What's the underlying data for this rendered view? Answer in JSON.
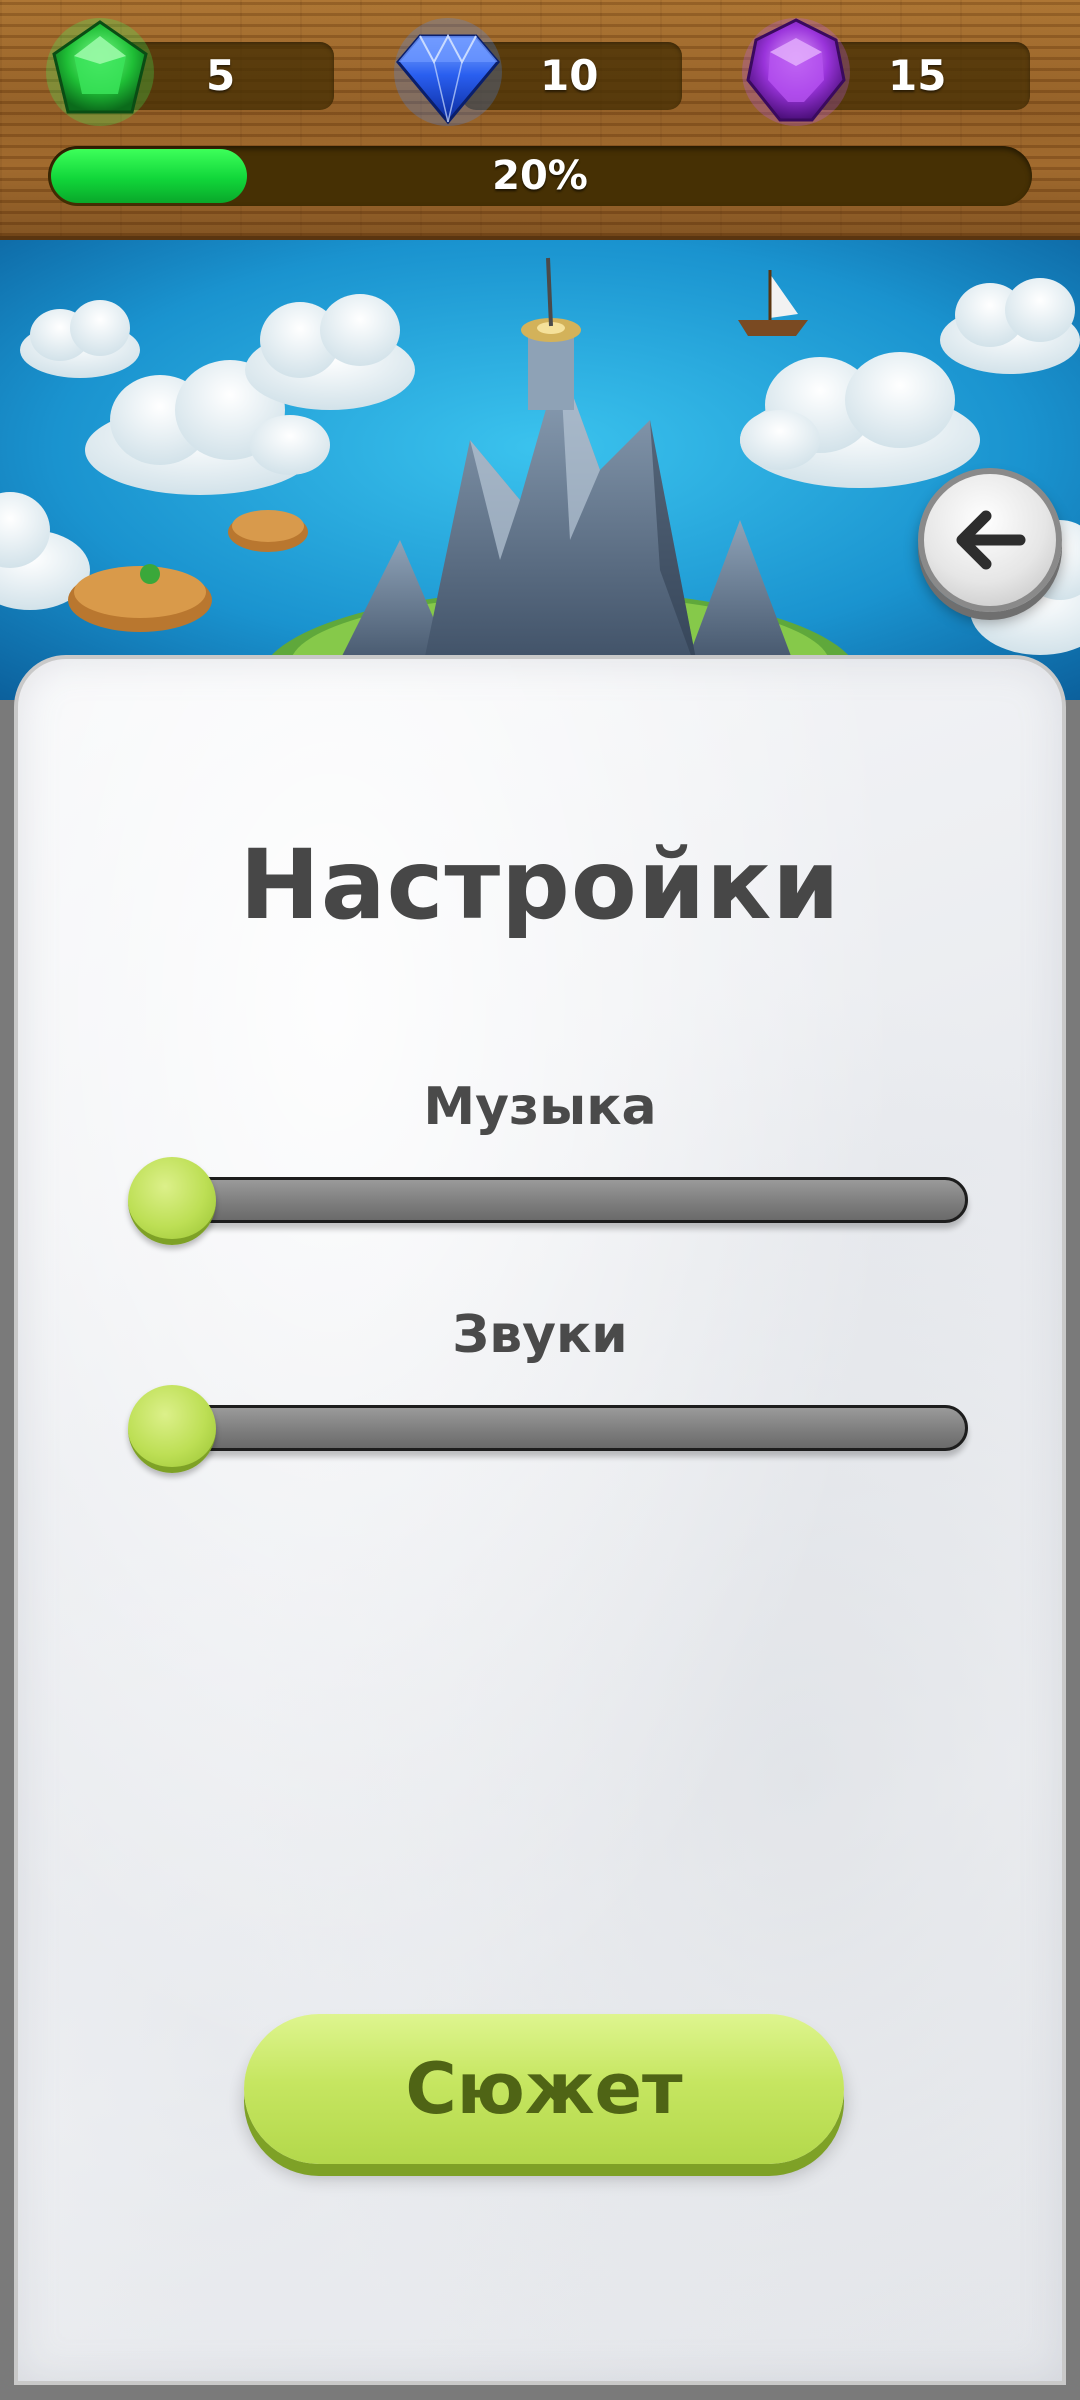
{
  "hud": {
    "gems": [
      {
        "name": "green-gem-icon",
        "count": "5",
        "color": "#22c23a"
      },
      {
        "name": "blue-gem-icon",
        "count": "10",
        "color": "#1f4fe0"
      },
      {
        "name": "purple-gem-icon",
        "count": "15",
        "color": "#8a2bd1"
      }
    ],
    "progress": {
      "label": "20%",
      "value": 0.2
    }
  },
  "scene": {
    "back_icon": "arrow-left-icon"
  },
  "settings": {
    "title": "Настройки",
    "music_label": "Музыка",
    "music_value": 0,
    "sounds_label": "Звуки",
    "sounds_value": 0,
    "story_button": "Сюжет"
  },
  "colors": {
    "accent": "#c6e661",
    "progress": "#11d63a",
    "wood": "#9c6428"
  }
}
